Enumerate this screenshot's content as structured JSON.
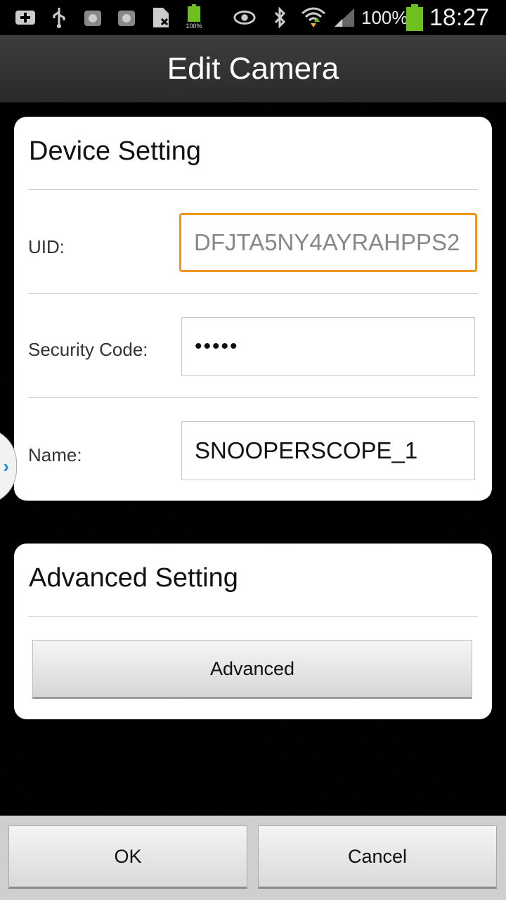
{
  "status_bar": {
    "battery_percent": "100%",
    "time": "18:27",
    "mini_battery_label": "100%"
  },
  "header": {
    "title": "Edit Camera"
  },
  "device_setting": {
    "title": "Device Setting",
    "uid_label": "UID:",
    "uid_value": "DFJTA5NY4AYRAHPPS2",
    "security_label": "Security Code:",
    "security_value": "•••••",
    "name_label": "Name:",
    "name_value": "SNOOPERSCOPE_1"
  },
  "advanced_setting": {
    "title": "Advanced Setting",
    "button_label": "Advanced"
  },
  "footer": {
    "ok_label": "OK",
    "cancel_label": "Cancel"
  },
  "side_tab": {
    "glyph": "›"
  },
  "colors": {
    "focus_border": "#f0961e",
    "side_tab_arrow": "#1b8fd1"
  }
}
